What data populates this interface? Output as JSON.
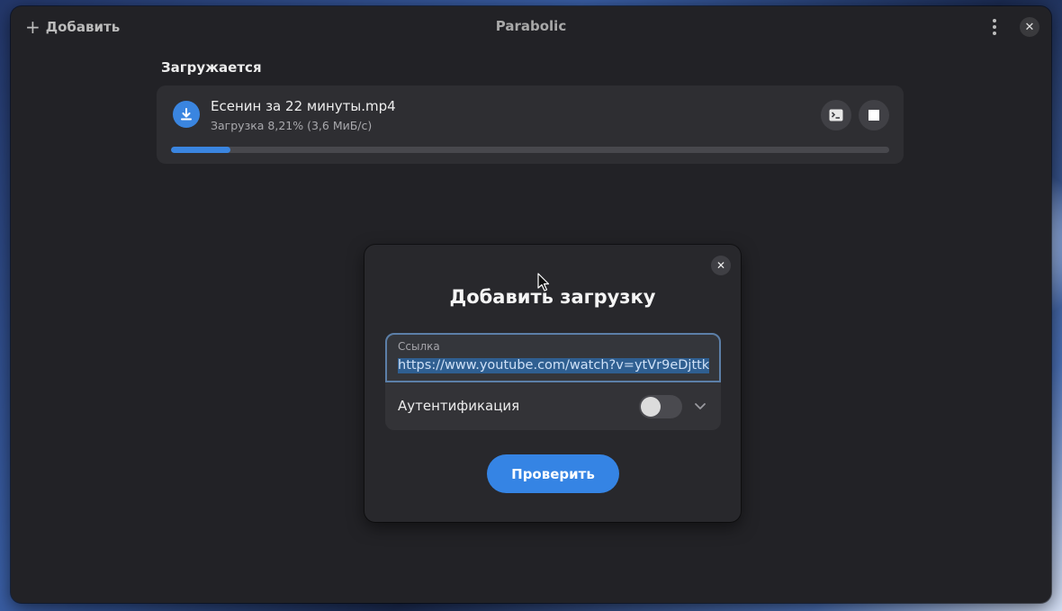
{
  "header": {
    "add_label": "Добавить",
    "title": "Parabolic",
    "menu_icon": "vertical-dots-icon",
    "close_icon": "close-icon"
  },
  "downloading": {
    "section_title": "Загружается",
    "item": {
      "name": "Есенин за 22 минуты.mp4",
      "status": "Загрузка 8,21% (3,6 МиБ/с)",
      "progress_percent": 8.21,
      "icon": "download-icon",
      "log_icon": "terminal-icon",
      "stop_icon": "stop-icon"
    }
  },
  "dialog": {
    "title": "Добавить загрузку",
    "url_label": "Ссылка",
    "url_value": "https://www.youtube.com/watch?v=ytVr9eDjttk",
    "auth_label": "Аутентификация",
    "auth_enabled": false,
    "check_label": "Проверить"
  },
  "colors": {
    "accent": "#3584e4",
    "window_bg": "#222226",
    "card_bg": "#2e2e32"
  }
}
